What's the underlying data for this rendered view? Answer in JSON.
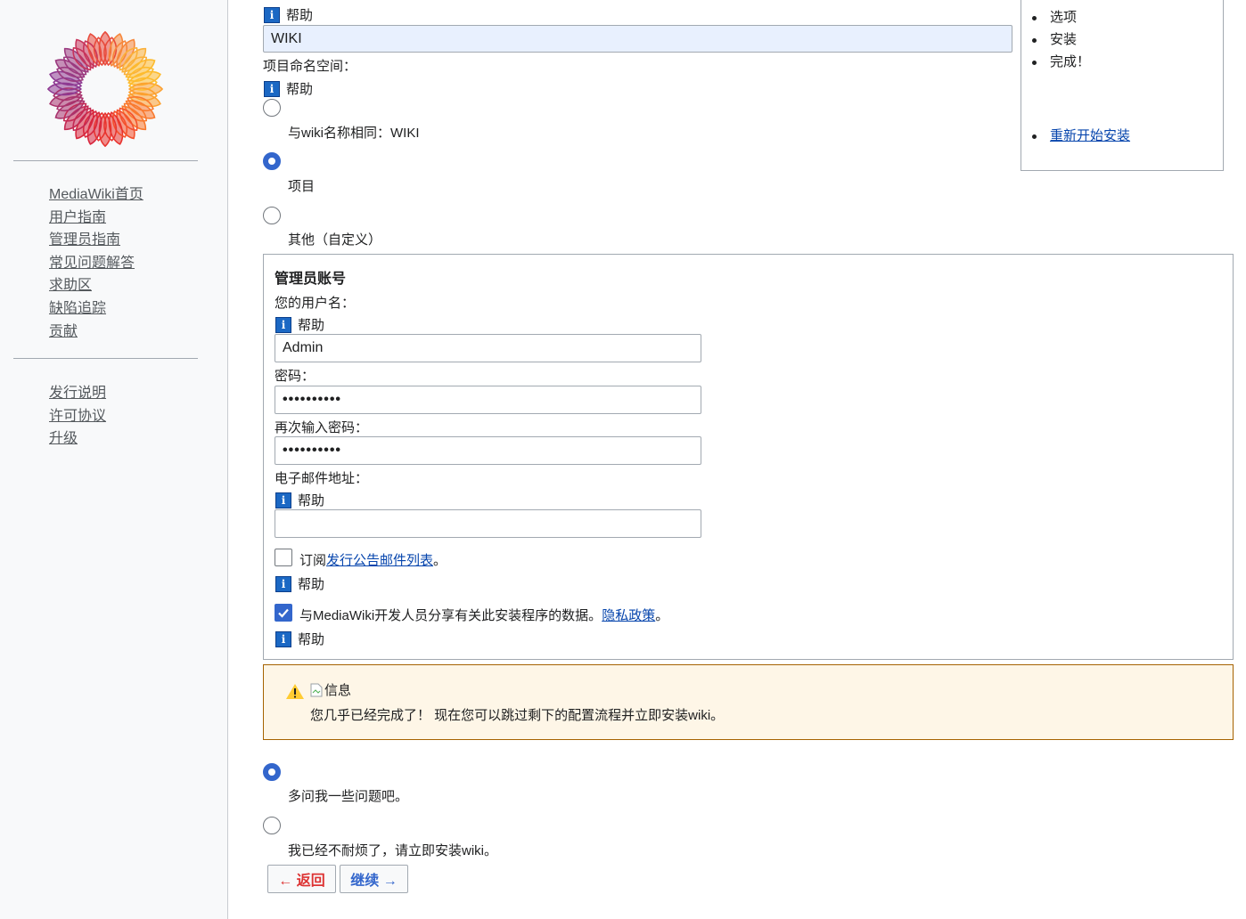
{
  "sidebar": {
    "nav_primary": [
      "MediaWiki首页",
      "用户指南",
      "管理员指南",
      "常见问题解答",
      "求助区",
      "缺陷追踪",
      "贡献"
    ],
    "nav_secondary": [
      "发行说明",
      "许可协议",
      "升级"
    ]
  },
  "toc": {
    "steps": [
      "选项",
      "安装",
      "完成！"
    ],
    "restart_link": "重新开始安装"
  },
  "help_label": "帮助",
  "wiki_name": {
    "value": "WIKI"
  },
  "project_namespace": {
    "label": "项目命名空间：",
    "options": [
      {
        "label": "与wiki名称相同：WIKI",
        "selected": false
      },
      {
        "label": "项目",
        "selected": true
      },
      {
        "label": "其他（自定义）",
        "selected": false
      }
    ]
  },
  "admin": {
    "legend": "管理员账号",
    "username_label": "您的用户名：",
    "username_value": "Admin",
    "password_label": "密码：",
    "password_value": "••••••••••",
    "password2_label": "再次输入密码：",
    "password2_value": "••••••••••",
    "email_label": "电子邮件地址：",
    "email_value": "",
    "subscribe_prefix": "订阅",
    "subscribe_link": "发行公告邮件列表",
    "subscribe_suffix": "。",
    "subscribe_checked": false,
    "share_text": "与MediaWiki开发人员分享有关此安装程序的数据。",
    "share_link": "隐私政策",
    "share_suffix": "。",
    "share_checked": true
  },
  "notice": {
    "img_alt": "信息",
    "text": "您几乎已经完成了！ 现在您可以跳过剩下的配置流程并立即安装wiki。"
  },
  "continue_options": [
    {
      "label": "多问我一些问题吧。",
      "selected": true
    },
    {
      "label": "我已经不耐烦了，请立即安装wiki。",
      "selected": false
    }
  ],
  "buttons": {
    "back": "← 返回",
    "next": "继续 →"
  }
}
